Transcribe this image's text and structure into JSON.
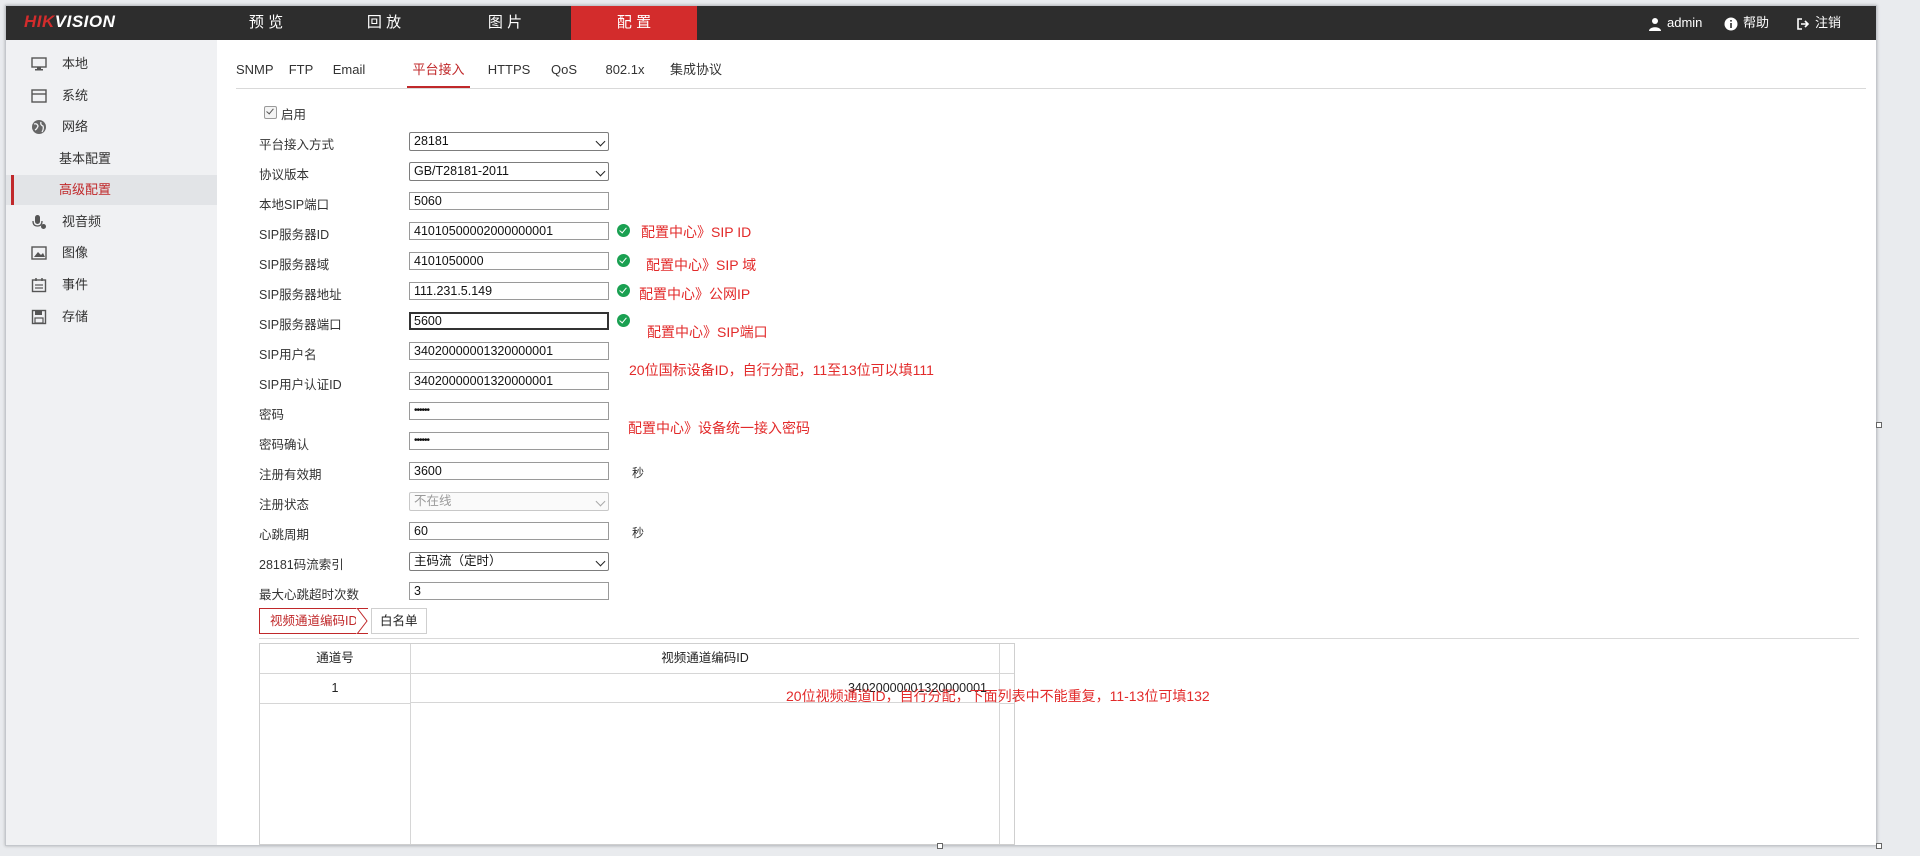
{
  "brand": {
    "logo_part1": "HIK",
    "logo_part2": "VISION"
  },
  "nav": {
    "items": [
      {
        "label": "预 览"
      },
      {
        "label": "回 放"
      },
      {
        "label": "图 片"
      },
      {
        "label": "配 置"
      }
    ],
    "active_index": 3
  },
  "user_menu": {
    "user": "admin",
    "help": "帮助",
    "logout": "注销"
  },
  "sidebar": {
    "items": [
      {
        "label": "本地",
        "icon": "monitor-icon"
      },
      {
        "label": "系统",
        "icon": "system-icon"
      },
      {
        "label": "网络",
        "icon": "globe-icon"
      },
      {
        "label": "基本配置"
      },
      {
        "label": "高级配置"
      },
      {
        "label": "视音频",
        "icon": "mic-icon"
      },
      {
        "label": "图像",
        "icon": "image-icon"
      },
      {
        "label": "事件",
        "icon": "calendar-icon"
      },
      {
        "label": "存储",
        "icon": "save-icon"
      }
    ],
    "active_item": "高级配置"
  },
  "tabs": {
    "items": [
      "SNMP",
      "FTP",
      "Email",
      "平台接入",
      "HTTPS",
      "QoS",
      "802.1x",
      "集成协议"
    ],
    "active": "平台接入"
  },
  "form": {
    "enable_label": "启用",
    "enable_checked": true,
    "access_mode_label": "平台接入方式",
    "access_mode_value": "28181",
    "protocol_version_label": "协议版本",
    "protocol_version_value": "GB/T28181-2011",
    "local_sip_port_label": "本地SIP端口",
    "local_sip_port_value": "5060",
    "sip_server_id_label": "SIP服务器ID",
    "sip_server_id_value": "41010500002000000001",
    "sip_server_domain_label": "SIP服务器域",
    "sip_server_domain_value": "4101050000",
    "sip_server_addr_label": "SIP服务器地址",
    "sip_server_addr_value": "111.231.5.149",
    "sip_server_port_label": "SIP服务器端口",
    "sip_server_port_value": "5600",
    "sip_user_label": "SIP用户名",
    "sip_user_value": "34020000001320000001",
    "sip_auth_id_label": "SIP用户认证ID",
    "sip_auth_id_value": "34020000001320000001",
    "password_label": "密码",
    "password_value": "••••••",
    "password_confirm_label": "密码确认",
    "password_confirm_value": "••••••",
    "reg_validity_label": "注册有效期",
    "reg_validity_value": "3600",
    "reg_validity_unit": "秒",
    "reg_status_label": "注册状态",
    "reg_status_value": "不在线",
    "heartbeat_label": "心跳周期",
    "heartbeat_value": "60",
    "heartbeat_unit": "秒",
    "stream_index_label": "28181码流索引",
    "stream_index_value": "主码流（定时）",
    "max_heartbeat_timeout_label": "最大心跳超时次数",
    "max_heartbeat_timeout_value": "3"
  },
  "annotations": {
    "sip_id": "配置中心》SIP ID",
    "sip_domain": "配置中心》SIP 域",
    "public_ip": "配置中心》公网IP",
    "sip_port": "配置中心》SIP端口",
    "device_id": "20位国标设备ID，自行分配，11至13位可以填111",
    "password": "配置中心》设备统一接入密码",
    "channel_id": "20位视频通道ID，自行分配，下面列表中不能重复，11-13位可填132"
  },
  "subtabs": {
    "items": [
      "视频通道编码ID",
      "白名单"
    ],
    "active": "视频通道编码ID"
  },
  "channel_table": {
    "headers": [
      "通道号",
      "视频通道编码ID"
    ],
    "rows": [
      {
        "channel": "1",
        "code_id": "34020000001320000001"
      }
    ]
  },
  "colors": {
    "accent": "#c0282a",
    "topbar": "#2d2d2d",
    "annotation": "#e22a2a",
    "ok": "#1aa051"
  }
}
